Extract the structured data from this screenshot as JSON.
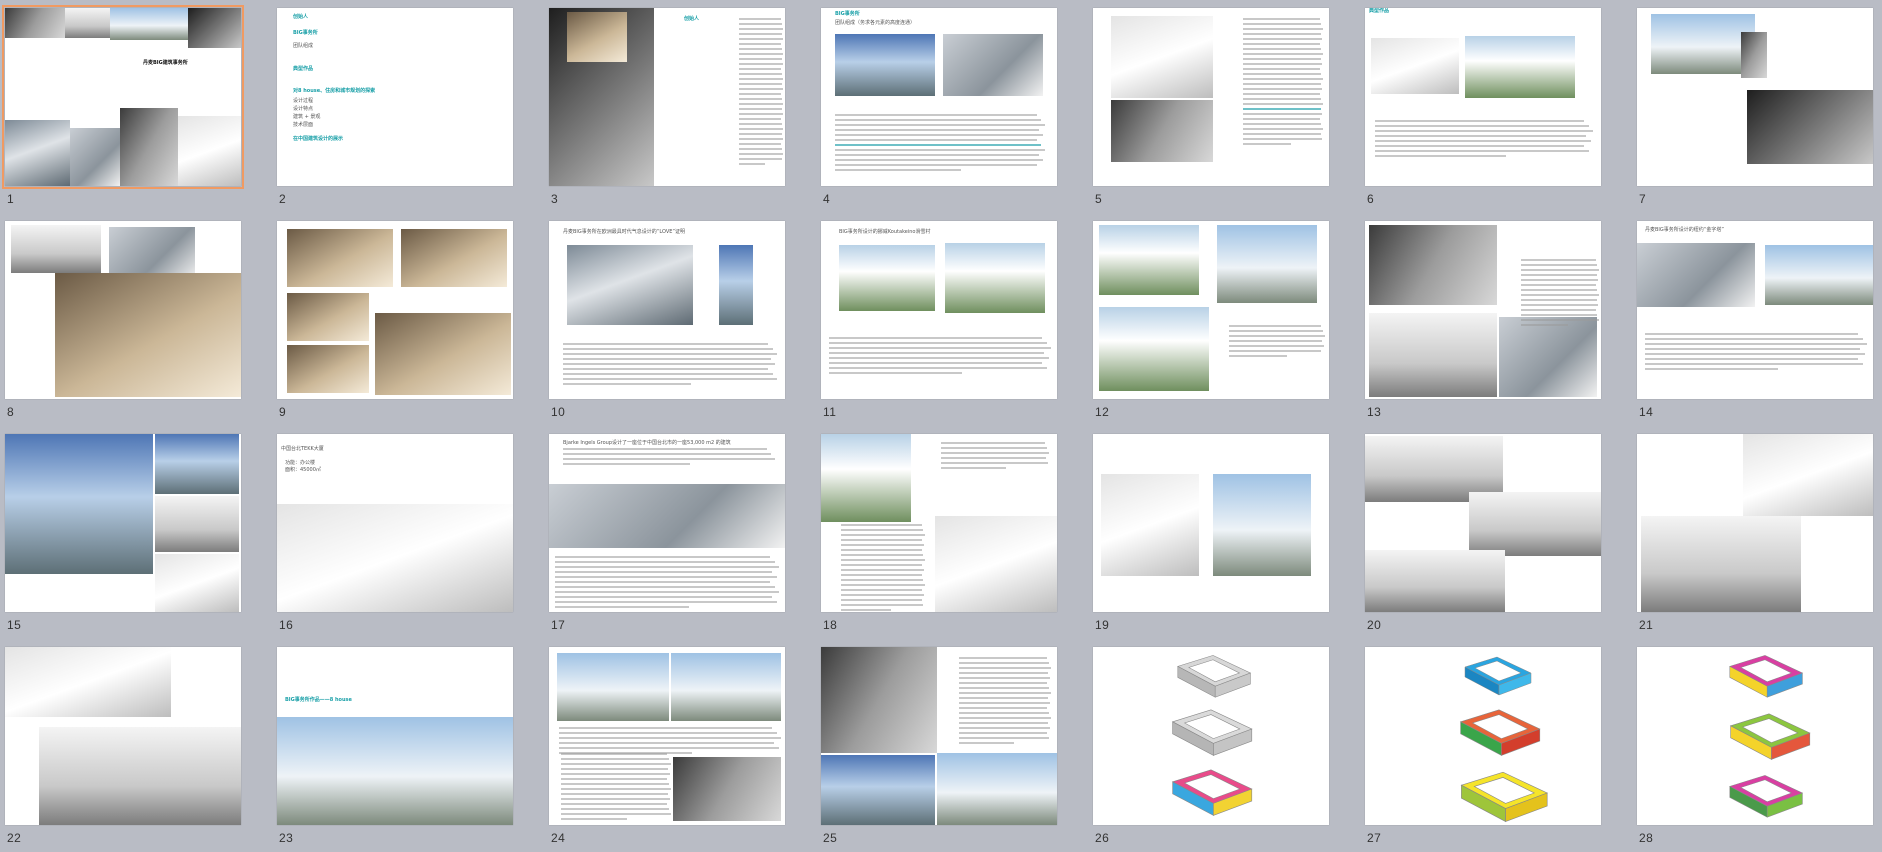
{
  "app": "slide-sorter",
  "colors": {
    "background": "#b9bcc5",
    "selection": "#f09a62",
    "accent": "#1aa0a8"
  },
  "selected_slide": 1,
  "slides": [
    {
      "number": "1",
      "title": "丹麦BIG建筑事务所"
    },
    {
      "number": "2",
      "items": [
        "创始人",
        "BIG事务所",
        "团队组成",
        "典型作品",
        "对8 house、住房和城市规划的探索",
        "设计过程",
        "设计特点",
        "建筑 + 景观",
        "技术层面",
        "在中国建筑设计的展示"
      ]
    },
    {
      "number": "3",
      "title": "创始人",
      "text": "Bjarke Ingels，1974年生于丹麦哥本哈根。于1993-1998年在丹麦皇家艺术学院学习建筑，曾在雷姆·库哈斯的OMA工作。2001年创立PLOT事务所，2006年创立BIG建筑事务所。"
    },
    {
      "number": "4",
      "title": "BIG事务所",
      "subtitle": "团队组成（务求各元素的高度连通）"
    },
    {
      "number": "5"
    },
    {
      "number": "6",
      "title": "典型作品"
    },
    {
      "number": "7"
    },
    {
      "number": "8"
    },
    {
      "number": "9"
    },
    {
      "number": "10",
      "title": "丹麦BIG事务所在欧洲最具时代气息设计的“LOVE”证明"
    },
    {
      "number": "11",
      "title": "BIG事务所设计的挪威Koutakeino滑雪村"
    },
    {
      "number": "12"
    },
    {
      "number": "13"
    },
    {
      "number": "14",
      "title": "丹麦BIG事务所设计的纽约“金字塔”"
    },
    {
      "number": "15"
    },
    {
      "number": "16",
      "title": "中国台北TEKK大厦",
      "meta": [
        "功能：办公楼",
        "面积：45000㎡"
      ]
    },
    {
      "number": "17",
      "title": "Bjarke Ingels Group设计了一座位于中国台北市的一座53,000 m2 的建筑"
    },
    {
      "number": "18"
    },
    {
      "number": "19"
    },
    {
      "number": "20"
    },
    {
      "number": "21"
    },
    {
      "number": "22"
    },
    {
      "number": "23",
      "title": "BIG事务所作品——8 house"
    },
    {
      "number": "24"
    },
    {
      "number": "25"
    },
    {
      "number": "26"
    },
    {
      "number": "27"
    },
    {
      "number": "28"
    }
  ]
}
